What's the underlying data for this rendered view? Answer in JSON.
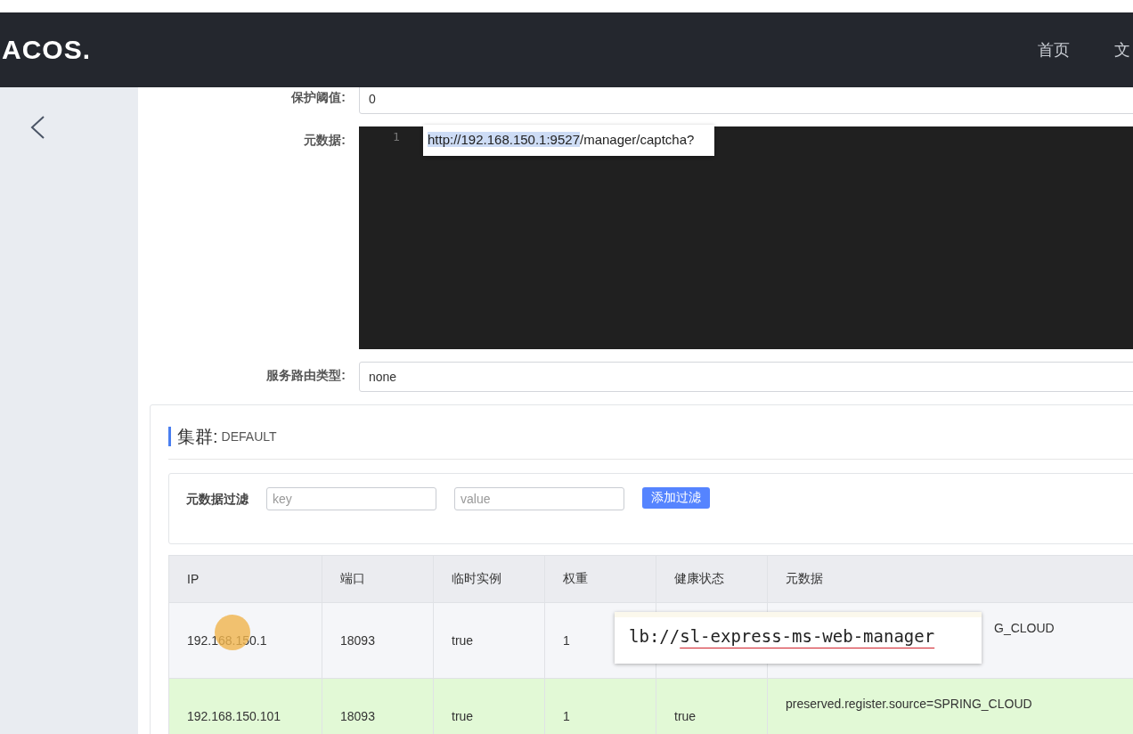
{
  "header": {
    "logo": "ACOS.",
    "nav": [
      {
        "label": "首页"
      },
      {
        "label": "文"
      }
    ]
  },
  "form": {
    "fields": [
      {
        "kind": "input",
        "label": "保护阈值:",
        "value": "0"
      },
      {
        "kind": "editor",
        "label": "元数据:",
        "line_number": "1"
      },
      {
        "kind": "input",
        "label": "服务路由类型:",
        "value": "none"
      }
    ]
  },
  "cluster": {
    "title": "集群:",
    "name": "DEFAULT",
    "filter": {
      "label": "元数据过滤",
      "key_placeholder": "key",
      "value_placeholder": "value",
      "button": "添加过滤"
    },
    "table": {
      "columns": [
        "IP",
        "端口",
        "临时实例",
        "权重",
        "健康状态",
        "元数据"
      ],
      "rows": [
        {
          "selected": false,
          "cells": [
            "192.168.150.1",
            "18093",
            "true",
            "1",
            "",
            "G_CLOUD"
          ]
        },
        {
          "selected": true,
          "cells": [
            "192.168.150.101",
            "18093",
            "true",
            "1",
            "true",
            "preserved.register.source=SPRING_CLOUD"
          ]
        }
      ]
    }
  },
  "url_popup": {
    "highlighted": "http://192.168.150.1:9527",
    "text": "/manager/captcha?"
  },
  "code_popup": {
    "prefix": "lb://",
    "underlined": "sl-express-ms-web-manager"
  }
}
